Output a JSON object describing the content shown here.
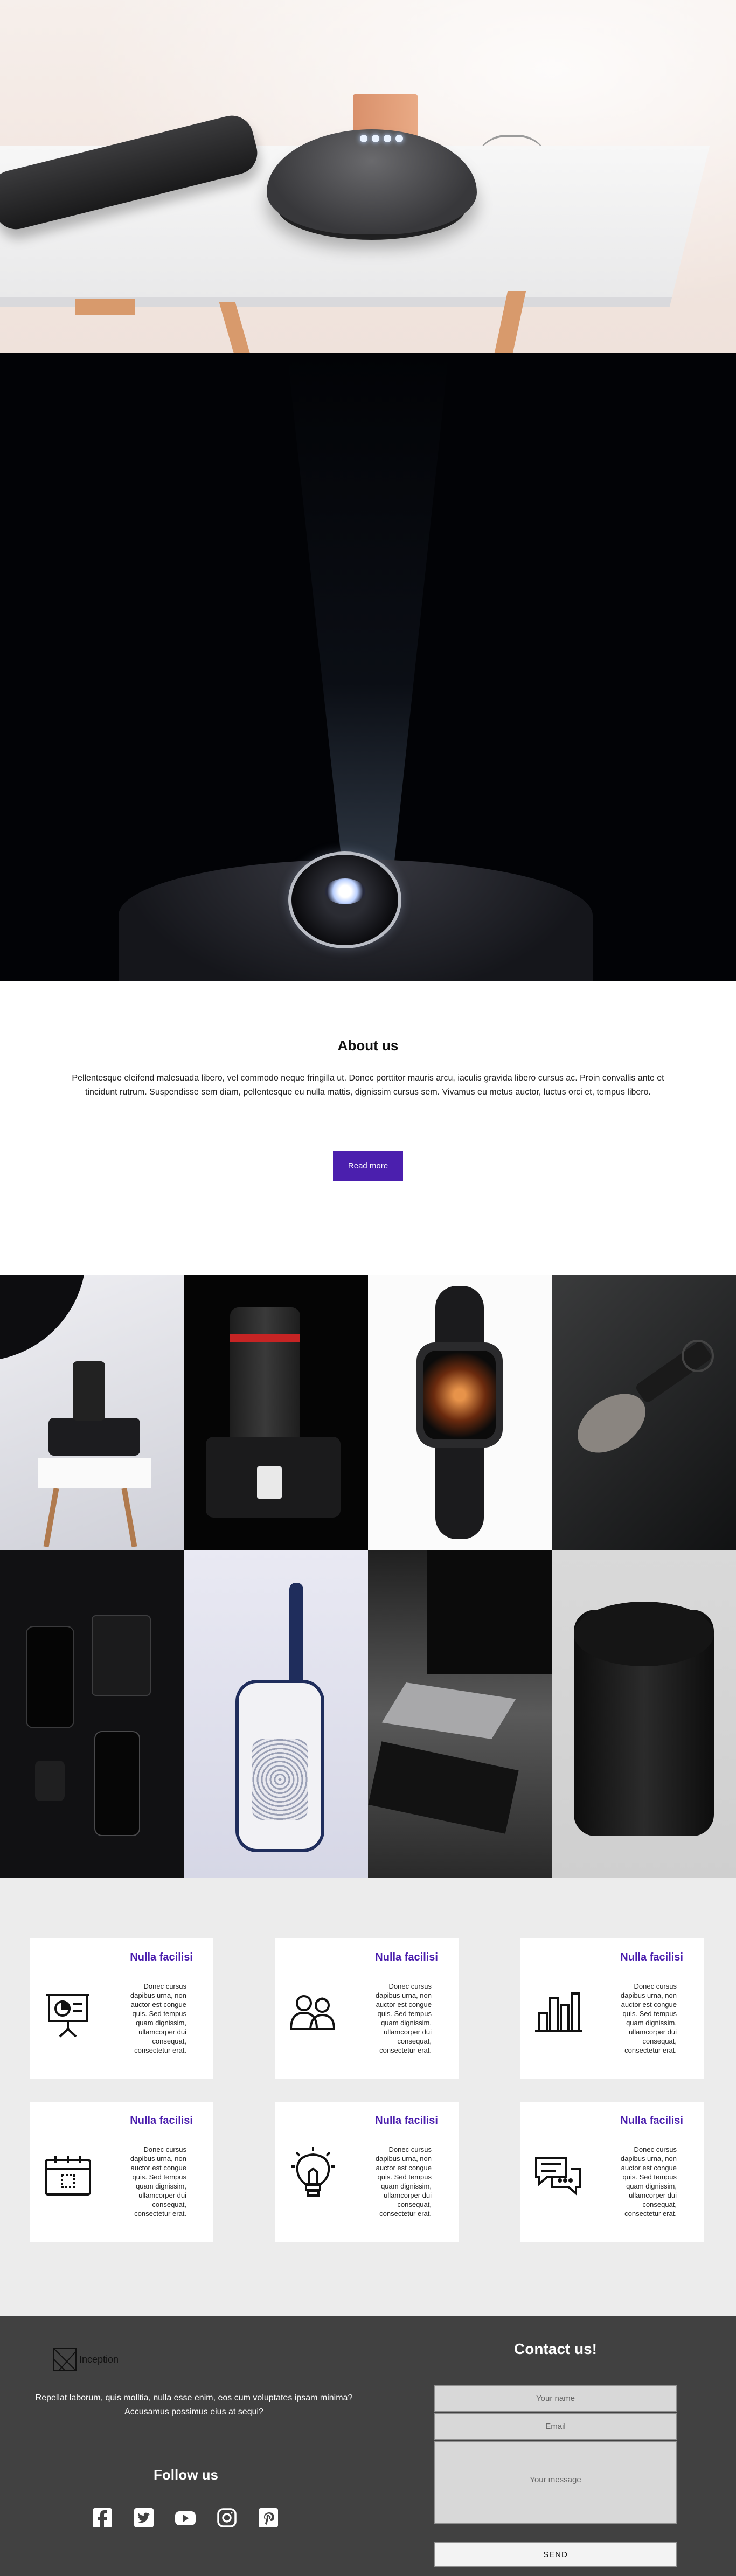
{
  "about": {
    "title": "About us",
    "body": "Pellentesque eleifend malesuada libero, vel commodo neque fringilla ut. Donec porttitor mauris arcu, iaculis gravida libero cursus ac. Proin convallis ante et tincidunt rutrum. Suspendisse sem diam, pellentesque eu nulla mattis, dignissim cursus sem. Vivamus eu metus auctor, luctus orci et, tempus libero.",
    "button": "Read more",
    "button_color": "#4b1fae"
  },
  "features": {
    "cards": [
      {
        "title": "Nulla facilisi",
        "text": "Donec cursus dapibus urna, non auctor est congue quis. Sed tempus quam dignissim, ullamcorper dui consequat, consectetur erat.",
        "icon": "presentation-board-icon"
      },
      {
        "title": "Nulla facilisi",
        "text": "Donec cursus dapibus urna, non auctor est congue quis. Sed tempus quam dignissim, ullamcorper dui consequat, consectetur erat.",
        "icon": "team-people-icon"
      },
      {
        "title": "Nulla facilisi",
        "text": "Donec cursus dapibus urna, non auctor est congue quis. Sed tempus quam dignissim, ullamcorper dui consequat, consectetur erat.",
        "icon": "bar-chart-icon"
      },
      {
        "title": "Nulla facilisi",
        "text": "Donec cursus dapibus urna, non auctor est congue quis. Sed tempus quam dignissim, ullamcorper dui consequat, consectetur erat.",
        "icon": "calendar-icon"
      },
      {
        "title": "Nulla facilisi",
        "text": "Donec cursus dapibus urna, non auctor est congue quis. Sed tempus quam dignissim, ullamcorper dui consequat, consectetur erat.",
        "icon": "light-bulb-icon"
      },
      {
        "title": "Nulla facilisi",
        "text": "Donec cursus dapibus urna, non auctor est congue quis. Sed tempus quam dignissim, ullamcorper dui consequat, consectetur erat.",
        "icon": "chat-bubbles-icon"
      }
    ],
    "accent_color": "#4b1fae"
  },
  "footer": {
    "logo_text": "Inception",
    "text": "Repellat laborum, quis molltia, nulla esse enim, eos cum voluptates ipsam minima? Accusamus possimus eius at sequi?",
    "follow_title": "Follow us",
    "socials": [
      "facebook-icon",
      "twitter-icon",
      "youtube-icon",
      "instagram-icon",
      "pinterest-icon"
    ],
    "contact_title": "Contact us!",
    "name_placeholder": "Your name",
    "email_placeholder": "Email",
    "message_placeholder": "Your message",
    "send_label": "SEND",
    "background": "#414141"
  }
}
